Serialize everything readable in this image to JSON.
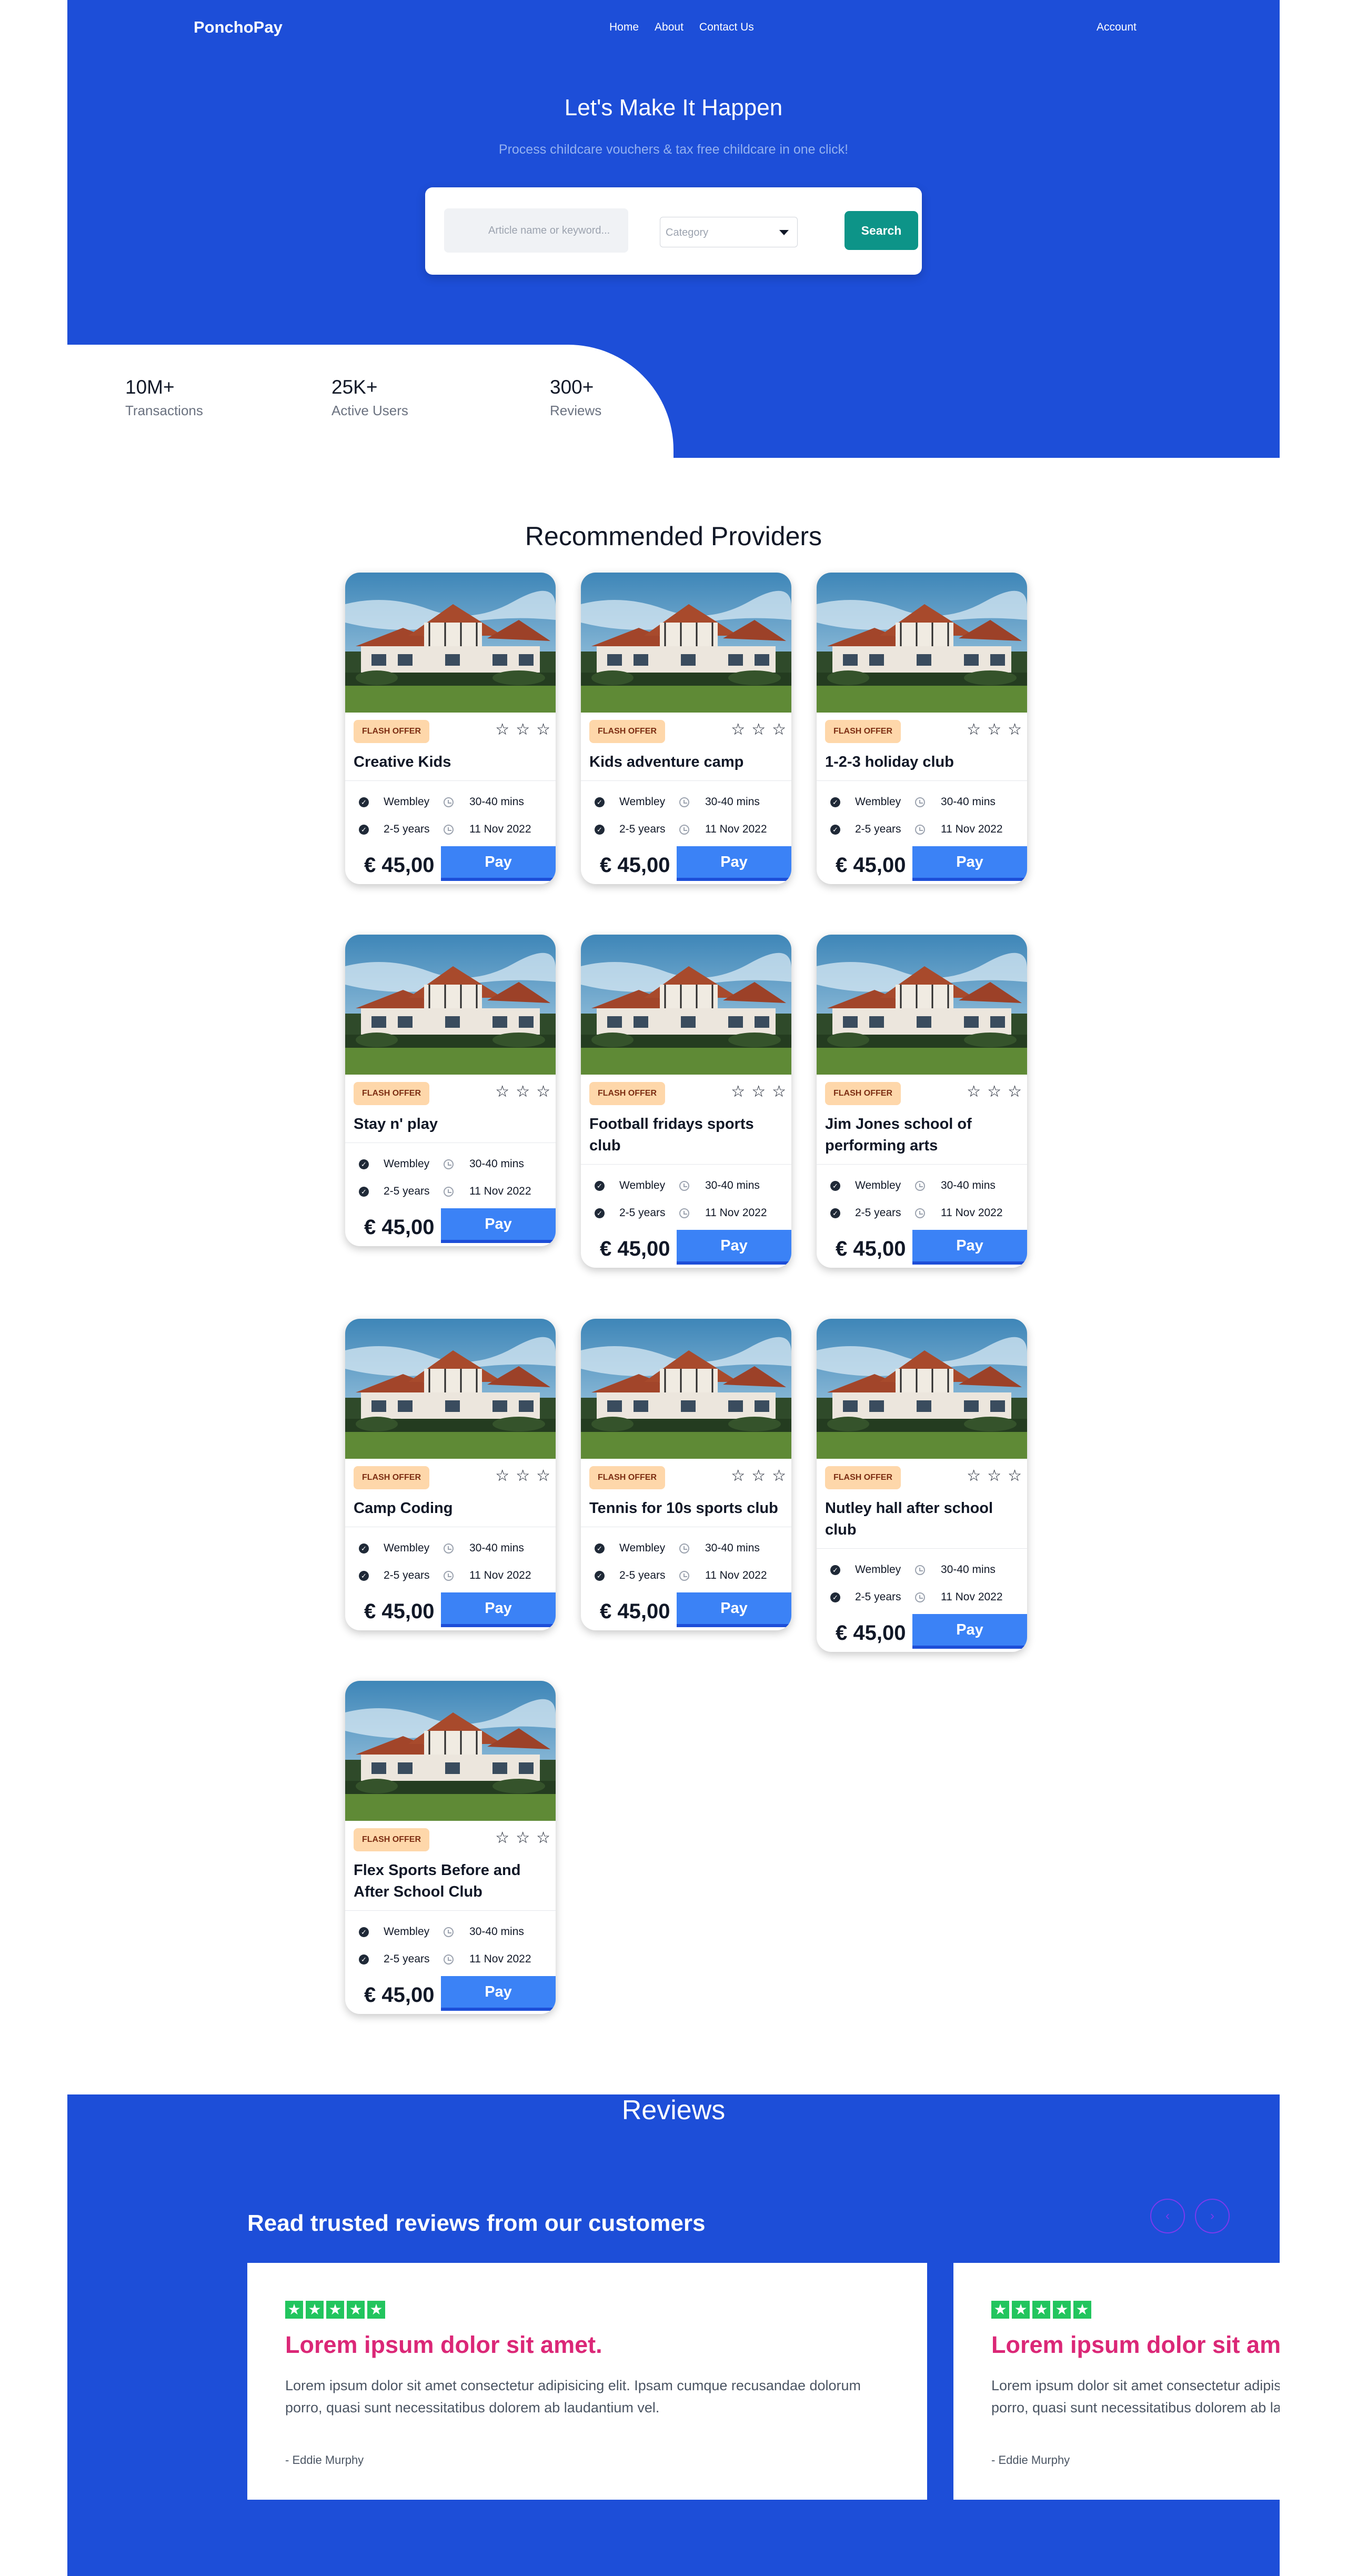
{
  "nav": {
    "logo": "PonchoPay",
    "links": [
      "Home",
      "About",
      "Contact Us"
    ],
    "account": "Account"
  },
  "hero": {
    "title": "Let's Make It Happen",
    "subtitle": "Process childcare vouchers & tax free childcare in one click!",
    "search": {
      "placeholder": "Article name or keyword...",
      "category_placeholder": "Category",
      "button": "Search"
    }
  },
  "stats": [
    {
      "value": "10M+",
      "label": "Transactions"
    },
    {
      "value": "25K+",
      "label": "Active Users"
    },
    {
      "value": "300+",
      "label": "Reviews"
    }
  ],
  "providers": {
    "title": "Recommended Providers",
    "items": [
      {
        "badge": "FLASH OFFER",
        "name": "Creative Kids",
        "location": "Wembley",
        "duration": "30-40 mins",
        "ages": "2-5 years",
        "date": "11 Nov 2022",
        "price": "€ 45,00",
        "pay": "Pay",
        "rating": 0
      },
      {
        "badge": "FLASH OFFER",
        "name": "Kids adventure camp",
        "location": "Wembley",
        "duration": "30-40 mins",
        "ages": "2-5 years",
        "date": "11 Nov 2022",
        "price": "€ 45,00",
        "pay": "Pay",
        "rating": 0
      },
      {
        "badge": "FLASH OFFER",
        "name": "1-2-3 holiday club",
        "location": "Wembley",
        "duration": "30-40 mins",
        "ages": "2-5 years",
        "date": "11 Nov 2022",
        "price": "€ 45,00",
        "pay": "Pay",
        "rating": 0
      },
      {
        "badge": "FLASH OFFER",
        "name": "Stay n' play",
        "location": "Wembley",
        "duration": "30-40 mins",
        "ages": "2-5 years",
        "date": "11 Nov 2022",
        "price": "€ 45,00",
        "pay": "Pay",
        "rating": 0
      },
      {
        "badge": "FLASH OFFER",
        "name": "Football fridays sports club",
        "location": "Wembley",
        "duration": "30-40 mins",
        "ages": "2-5 years",
        "date": "11 Nov 2022",
        "price": "€ 45,00",
        "pay": "Pay",
        "rating": 0
      },
      {
        "badge": "FLASH OFFER",
        "name": "Jim Jones school of performing arts",
        "location": "Wembley",
        "duration": "30-40 mins",
        "ages": "2-5 years",
        "date": "11 Nov 2022",
        "price": "€ 45,00",
        "pay": "Pay",
        "rating": 0
      },
      {
        "badge": "FLASH OFFER",
        "name": "Camp Coding",
        "location": "Wembley",
        "duration": "30-40 mins",
        "ages": "2-5 years",
        "date": "11 Nov 2022",
        "price": "€ 45,00",
        "pay": "Pay",
        "rating": 0
      },
      {
        "badge": "FLASH OFFER",
        "name": "Tennis for 10s sports club",
        "location": "Wembley",
        "duration": "30-40 mins",
        "ages": "2-5 years",
        "date": "11 Nov 2022",
        "price": "€ 45,00",
        "pay": "Pay",
        "rating": 0
      },
      {
        "badge": "FLASH OFFER",
        "name": "Nutley hall after school club",
        "location": "Wembley",
        "duration": "30-40 mins",
        "ages": "2-5 years",
        "date": "11 Nov 2022",
        "price": "€ 45,00",
        "pay": "Pay",
        "rating": 0
      },
      {
        "badge": "FLASH OFFER",
        "name": "Flex Sports Before and After School Club",
        "location": "Wembley",
        "duration": "30-40 mins",
        "ages": "2-5 years",
        "date": "11 Nov 2022",
        "price": "€ 45,00",
        "pay": "Pay",
        "rating": 0
      }
    ]
  },
  "reviews": {
    "heading": "Reviews",
    "subheading": "Read trusted reviews from our customers",
    "prev_icon": "chevron-left-icon",
    "next_icon": "chevron-right-icon",
    "star_color": "#22c55e",
    "items": [
      {
        "rating": 5,
        "title": "Lorem ipsum dolor sit amet.",
        "body": "Lorem ipsum dolor sit amet consectetur adipisicing elit. Ipsam cumque recusandae dolorum porro, quasi sunt necessitatibus dolorem ab laudantium vel.",
        "author": "- Eddie Murphy"
      },
      {
        "rating": 5,
        "title": "Lorem ipsum dolor sit amet.",
        "body": "Lorem ipsum dolor sit amet consectetur adipisicing elit. Ipsam cumque recusandae dolorum porro, quasi sunt necessitatibus dolorem ab laudantium vel.",
        "author": "- Eddie Murphy"
      }
    ]
  },
  "colors": {
    "brand_blue": "#1d4ed8",
    "pay_blue": "#3b82f6",
    "search_teal": "#0d9488",
    "badge_bg": "#fed7aa",
    "review_title": "#db2777"
  }
}
